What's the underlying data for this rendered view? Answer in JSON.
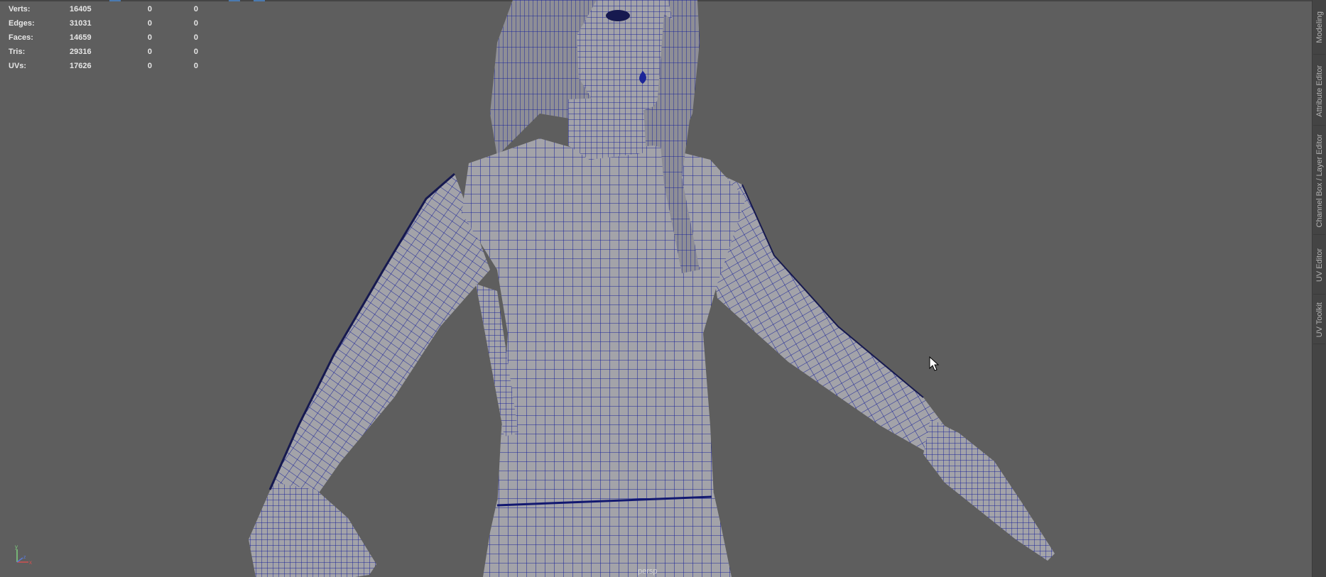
{
  "hud": {
    "rows": [
      {
        "label": "Verts:",
        "value": "16405",
        "selected": "0",
        "uv": "0"
      },
      {
        "label": "Edges:",
        "value": "31031",
        "selected": "0",
        "uv": "0"
      },
      {
        "label": "Faces:",
        "value": "14659",
        "selected": "0",
        "uv": "0"
      },
      {
        "label": "Tris:",
        "value": "29316",
        "selected": "0",
        "uv": "0"
      },
      {
        "label": "UVs:",
        "value": "17626",
        "selected": "0",
        "uv": "0"
      }
    ]
  },
  "viewport": {
    "camera_label": "persp",
    "background_color": "#5e5e5e",
    "mesh_color": "#a3a3a9",
    "wire_color": "#1c2598"
  },
  "axis": {
    "y": "y",
    "x": "x",
    "z": "z"
  },
  "side_tabs": [
    {
      "label": "Modeling"
    },
    {
      "label": "Attribute Editor"
    },
    {
      "label": "Channel Box / Layer Editor"
    },
    {
      "label": "UV Editor"
    },
    {
      "label": "UV Toolkit"
    }
  ],
  "icons": {
    "cursor": "mouse-pointer-icon",
    "axis": "axis-gizmo-icon"
  }
}
